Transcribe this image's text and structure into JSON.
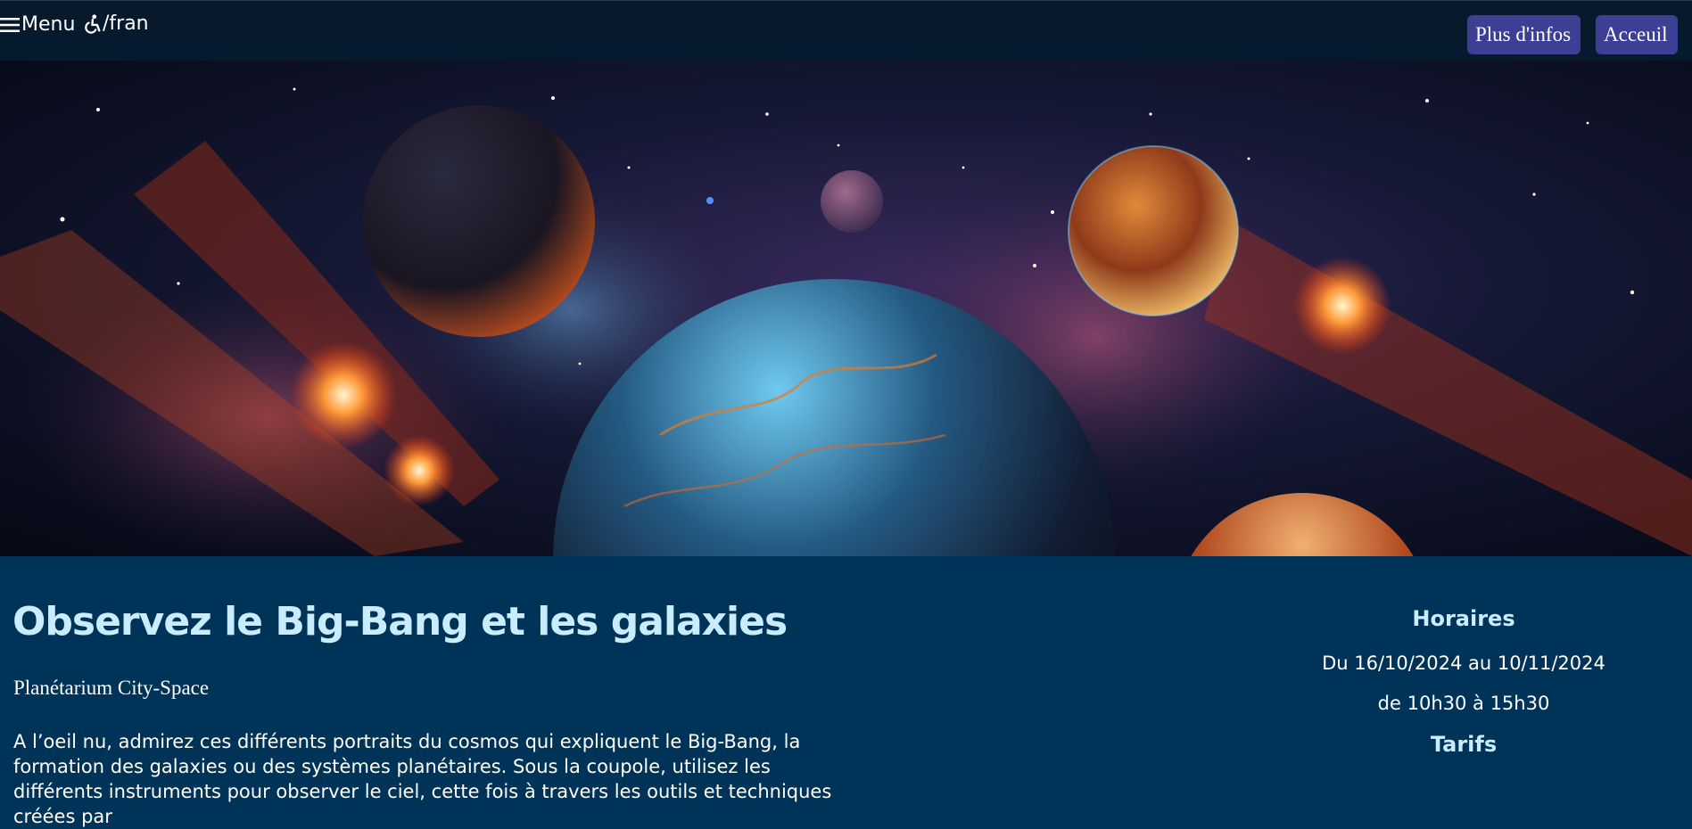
{
  "header": {
    "menu_label": "Menu",
    "lang_label": "/fran",
    "buttons": {
      "infos": "Plus d'infos",
      "accueil": "Acceuil"
    }
  },
  "main": {
    "title": "Observez le Big-Bang et les galaxies",
    "subtitle": "Planétarium City-Space",
    "description": "A l’oeil nu, admirez ces différents portraits du cosmos qui expliquent le Big-Bang, la formation des galaxies ou des systèmes planétaires. Sous la coupole, utilisez les différents instruments pour observer le ciel, cette fois à travers les outils et techniques créées par"
  },
  "aside": {
    "horaires_title": "Horaires",
    "dates": "Du 16/10/2024 au 10/11/2024",
    "hours": "de 10h30 à 15h30",
    "tarifs_title": "Tarifs"
  },
  "colors": {
    "header_bg": "#061a2b",
    "button_bg": "#3d3f95",
    "content_bg": "#003358",
    "heading": "#c9ecff"
  }
}
